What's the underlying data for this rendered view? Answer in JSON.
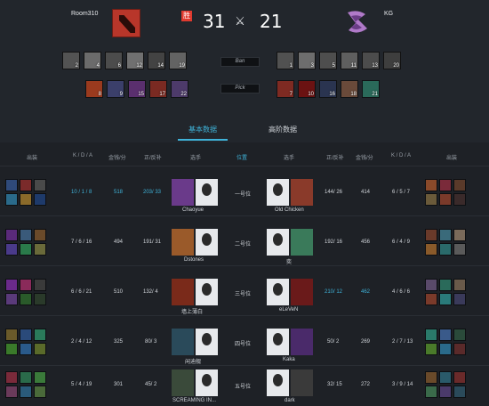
{
  "header": {
    "left_team": "Room310",
    "right_team": "KG",
    "left_score": "31",
    "right_score": "21",
    "badge": "胜",
    "ban_label": "Ban",
    "pick_label": "Pick",
    "left_bans": [
      "2",
      "4",
      "6",
      "12",
      "14",
      "19"
    ],
    "right_bans": [
      "1",
      "3",
      "5",
      "11",
      "13",
      "20"
    ],
    "left_picks": [
      "8",
      "9",
      "15",
      "17",
      "22"
    ],
    "right_picks": [
      "7",
      "10",
      "16",
      "18",
      "21"
    ]
  },
  "tabs": {
    "basic": "基本数据",
    "advanced": "高阶数据"
  },
  "columns": {
    "items_left": "出装",
    "kda_left": "K / D / A",
    "gpm_left": "金钱/分",
    "lhd_left": "正/反补",
    "player_left": "选手",
    "position": "位置",
    "player_right": "选手",
    "lhd_right": "正/反补",
    "gpm_right": "金钱/分",
    "kda_right": "K / D / A",
    "items_right": "出装"
  },
  "rows": [
    {
      "kda_l": "10 / 1 / 8",
      "gpm_l": "518",
      "lhd_l": "203/ 33",
      "player_l": "Chaoyue",
      "pos": "一号位",
      "player_r": "Old Chicken",
      "lhd_r": "144/ 26",
      "gpm_r": "414",
      "kda_r": "6 / 5 / 7"
    },
    {
      "kda_l": "7 / 6 / 16",
      "gpm_l": "494",
      "lhd_l": "191/ 31",
      "player_l": "Dstones",
      "pos": "二号位",
      "player_r": "奕",
      "lhd_r": "192/ 16",
      "gpm_r": "456",
      "kda_r": "6 / 4 / 9"
    },
    {
      "kda_l": "6 / 6 / 21",
      "gpm_l": "510",
      "lhd_l": "132/ 4",
      "player_l": "墙上薄白",
      "pos": "三号位",
      "player_r": "eLeVeN",
      "lhd_r": "210/ 12",
      "gpm_r": "462",
      "kda_r": "4 / 6 / 6"
    },
    {
      "kda_l": "2 / 4 / 12",
      "gpm_l": "325",
      "lhd_l": "80/ 3",
      "player_l": "闲迪舰",
      "pos": "四号位",
      "player_r": "Kaka",
      "lhd_r": "50/ 2",
      "gpm_r": "269",
      "kda_r": "2 / 7 / 13"
    },
    {
      "kda_l": "5 / 4 / 19",
      "gpm_l": "301",
      "lhd_l": "45/ 2",
      "player_l": "SCREAMING IN...",
      "pos": "五号位",
      "player_r": "dark",
      "lhd_r": "32/ 15",
      "gpm_r": "272",
      "kda_r": "3 / 9 / 14"
    }
  ]
}
